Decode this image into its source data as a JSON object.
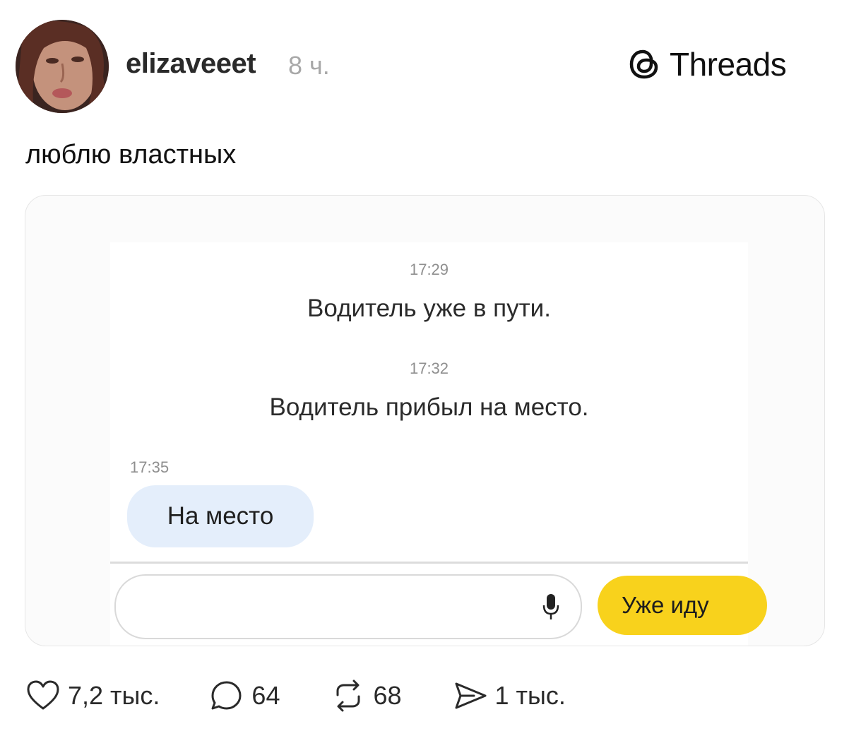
{
  "post": {
    "username": "elizaveeet",
    "time_ago": "8 ч.",
    "caption": "люблю властных"
  },
  "brand": {
    "icon": "threads-logo-icon",
    "name": "Threads"
  },
  "screenshot": {
    "messages": [
      {
        "time": "17:29",
        "text": "Водитель уже в пути."
      },
      {
        "time": "17:32",
        "text": "Водитель прибыл на место."
      }
    ],
    "reply": {
      "time": "17:35",
      "text": "На место"
    },
    "input": {
      "placeholder": "",
      "mic_icon": "microphone-icon"
    },
    "quick_reply_button": "Уже иду",
    "accent_color": "#f8d21c",
    "bubble_color": "#e4eefb"
  },
  "actions": {
    "likes": "7,2 тыс.",
    "comments": "64",
    "reposts": "68",
    "shares": "1 тыс."
  }
}
